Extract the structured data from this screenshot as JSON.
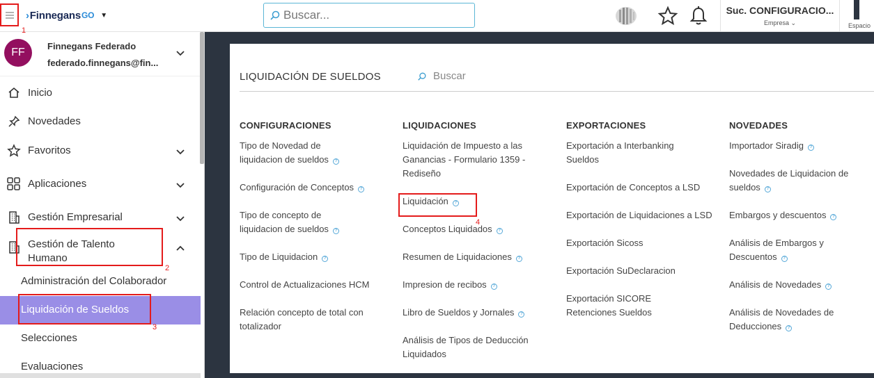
{
  "topbar": {
    "logo_text": "Finnegans",
    "logo_suffix": "GO",
    "search_placeholder": "Buscar...",
    "branch_name": "Suc. CONFIGURACIO...",
    "branch_sub": "Empresa",
    "space_label": "Espacio"
  },
  "user": {
    "initials": "FF",
    "name": "Finnegans Federado",
    "email": "federado.finnegans@fin..."
  },
  "sidebar": {
    "items": [
      {
        "label": "Inicio"
      },
      {
        "label": "Novedades"
      },
      {
        "label": "Favoritos"
      },
      {
        "label": "Aplicaciones"
      },
      {
        "label": "Gestión Empresarial"
      },
      {
        "label": "Gestión de Talento Humano"
      }
    ],
    "subitems": [
      {
        "label": "Administración del Colaborador"
      },
      {
        "label": "Liquidación de Sueldos"
      },
      {
        "label": "Selecciones"
      },
      {
        "label": "Evaluaciones"
      }
    ]
  },
  "main": {
    "title": "LIQUIDACIÓN DE SUELDOS",
    "search_placeholder": "Buscar",
    "columns": [
      {
        "header": "CONFIGURACIONES",
        "links": [
          "Tipo de Novedad de liquidacion de sueldos",
          "Configuración de Conceptos",
          "Tipo de concepto de liquidacion de sueldos",
          "Tipo de Liquidacion",
          "Control de Actualizaciones HCM",
          "Relación concepto de total con totalizador"
        ]
      },
      {
        "header": "LIQUIDACIONES",
        "links": [
          "Liquidación de Impuesto a las Ganancias - Formulario 1359 - Rediseño",
          "Liquidación",
          "Conceptos Liquidados",
          "Resumen de Liquidaciones",
          "Impresion de recibos",
          "Libro de Sueldos y Jornales",
          "Análisis de Tipos de Deducción Liquidados"
        ]
      },
      {
        "header": "EXPORTACIONES",
        "links": [
          "Exportación a Interbanking Sueldos",
          "Exportación de Conceptos a LSD",
          "Exportación de Liquidaciones a LSD",
          "Exportación Sicoss",
          "Exportación SuDeclaracion",
          "Exportación SICORE Retenciones Sueldos"
        ]
      },
      {
        "header": "NOVEDADES",
        "links": [
          "Importador Siradig",
          "Novedades de Liquidacion de sueldos",
          "Embargos y descuentos",
          "Análisis de Embargos y Descuentos",
          "Análisis de Novedades",
          "Análisis de Novedades de Deducciones"
        ]
      }
    ]
  },
  "annotations": [
    "1",
    "2",
    "3",
    "4"
  ],
  "colors": {
    "active_item": "#9a8ee6",
    "avatar": "#930f5f",
    "main_bg": "#2c3440",
    "annotation": "#e41b1b",
    "accent": "#2a8bd8"
  }
}
